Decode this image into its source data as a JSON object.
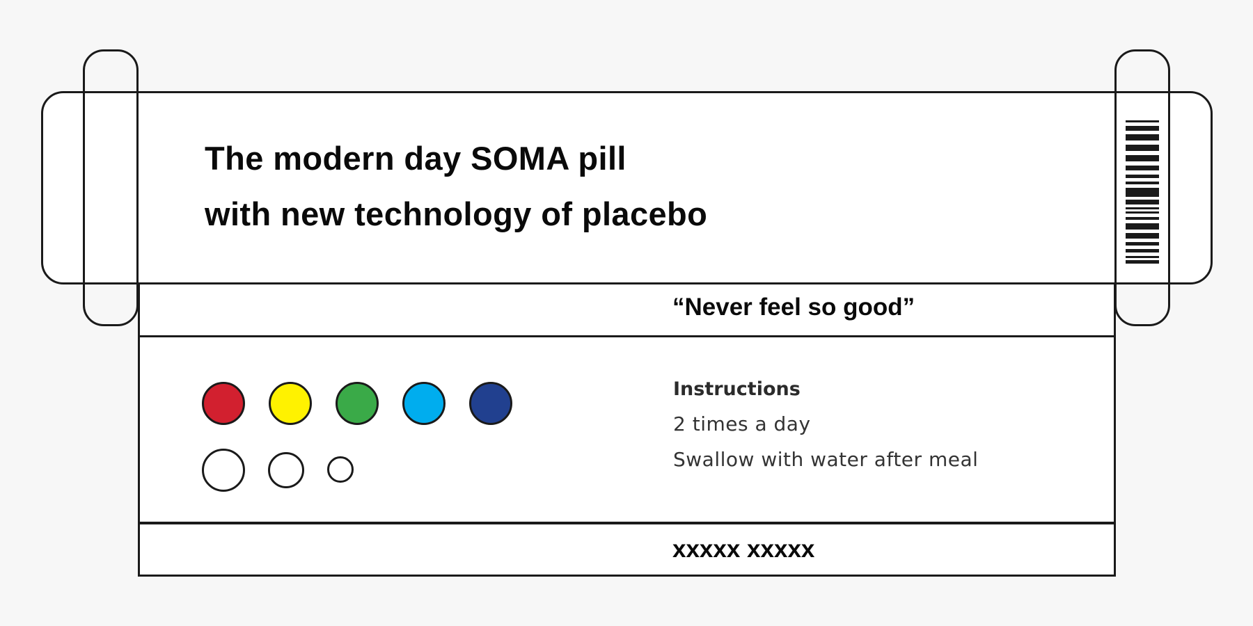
{
  "headline": {
    "line1": "The modern day SOMA pill",
    "line2": "with new technology of placebo"
  },
  "tagline": "“Never feel so good”",
  "instructions": {
    "title": "Instructions",
    "lines": [
      "2 times a day",
      "Swallow with water after meal"
    ]
  },
  "footer_text": "xxxxx xxxxx",
  "colors": {
    "outline": "#1a1a1a",
    "background": "#f7f7f7",
    "panel": "#ffffff"
  },
  "pills": {
    "colored": [
      {
        "name": "red",
        "color": "#d2202f"
      },
      {
        "name": "yellow",
        "color": "#fff200"
      },
      {
        "name": "green",
        "color": "#3aaa48"
      },
      {
        "name": "cyan",
        "color": "#00adee"
      },
      {
        "name": "navy",
        "color": "#21408f"
      }
    ],
    "outline_sizes": [
      "large",
      "medium",
      "small"
    ]
  }
}
